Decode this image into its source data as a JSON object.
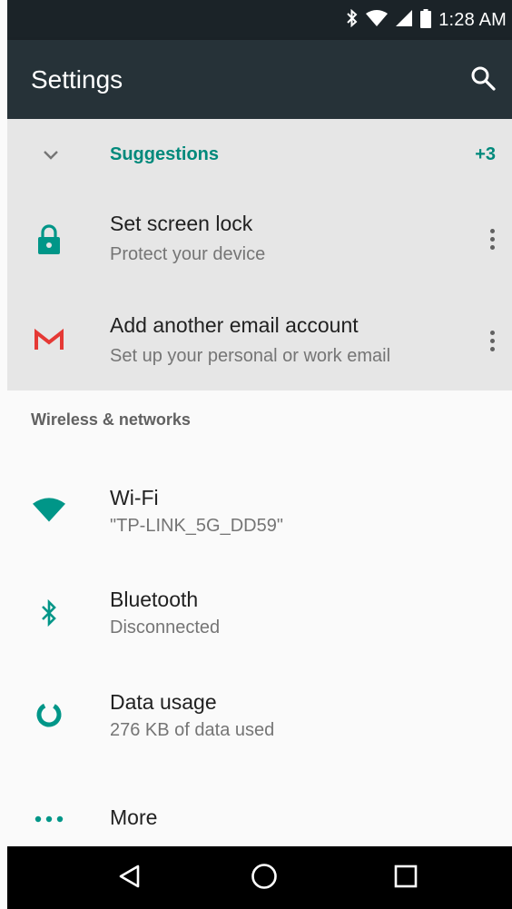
{
  "status": {
    "time": "1:28 AM"
  },
  "appbar": {
    "title": "Settings",
    "search_icon": "search-icon"
  },
  "suggestions": {
    "title": "Suggestions",
    "count": "+3",
    "items": [
      {
        "icon": "lock-icon",
        "title": "Set screen lock",
        "subtitle": "Protect your device"
      },
      {
        "icon": "gmail-icon",
        "title": "Add another email account",
        "subtitle": "Set up your personal or work email"
      }
    ]
  },
  "wireless": {
    "header": "Wireless & networks",
    "items": [
      {
        "icon": "wifi-icon",
        "title": "Wi-Fi",
        "subtitle": "\"TP-LINK_5G_DD59\""
      },
      {
        "icon": "bluetooth-icon",
        "title": "Bluetooth",
        "subtitle": "Disconnected"
      },
      {
        "icon": "data-usage-icon",
        "title": "Data usage",
        "subtitle": "276 KB of data used"
      },
      {
        "icon": "more-icon",
        "title": "More"
      }
    ]
  },
  "colors": {
    "accent": "#009688",
    "appbar": "#263238",
    "statusbar": "#1b2328",
    "suggestion_bg": "#e6e6e6",
    "gmail_red": "#e53935"
  }
}
